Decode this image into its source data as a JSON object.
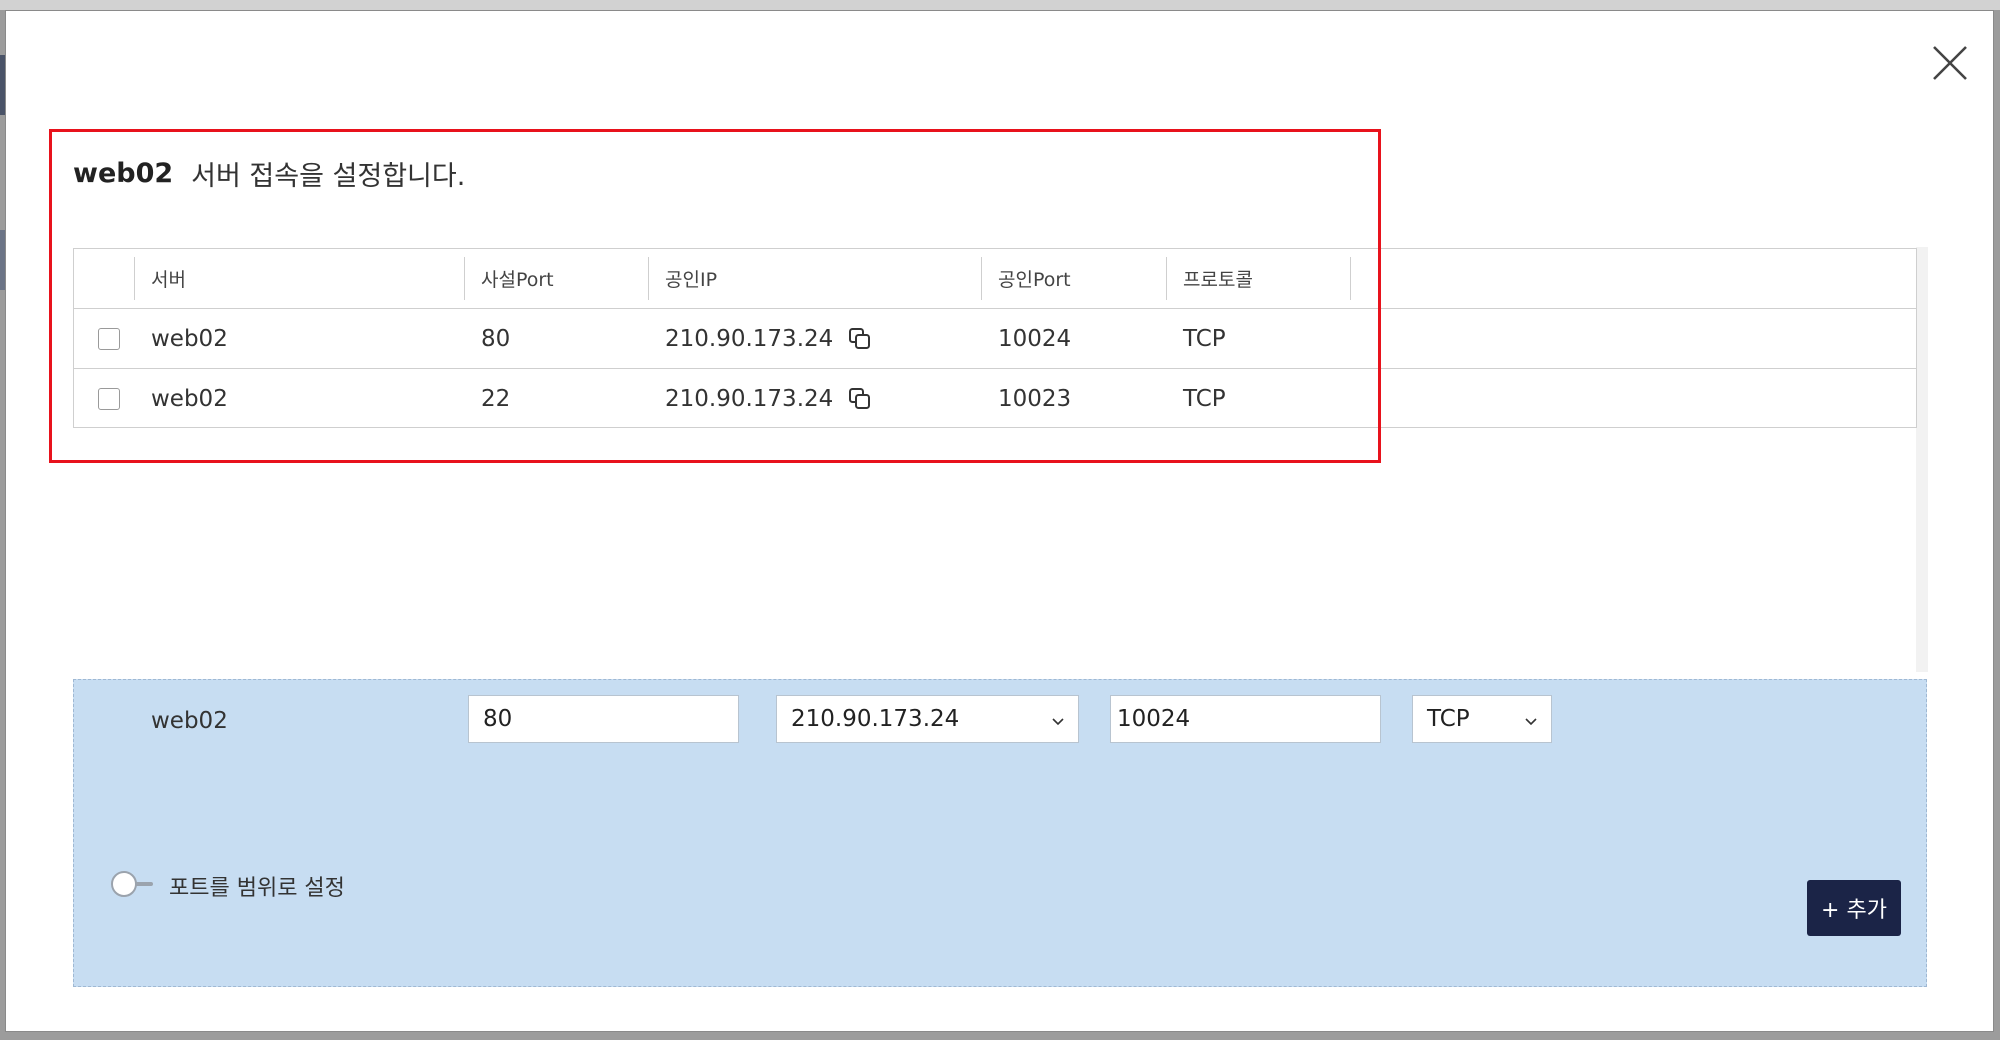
{
  "modal": {
    "title_server": "web02",
    "title_text": "서버 접속을 설정합니다."
  },
  "table": {
    "headers": {
      "server": "서버",
      "private_port": "사설Port",
      "public_ip": "공인IP",
      "public_port": "공인Port",
      "protocol": "프로토콜"
    },
    "rows": [
      {
        "server": "web02",
        "private_port": "80",
        "public_ip": "210.90.173.24",
        "public_port": "10024",
        "protocol": "TCP"
      },
      {
        "server": "web02",
        "private_port": "22",
        "public_ip": "210.90.173.24",
        "public_port": "10023",
        "protocol": "TCP"
      }
    ]
  },
  "form": {
    "server": "web02",
    "private_port": "80",
    "public_ip": "210.90.173.24",
    "public_port": "10024",
    "protocol": "TCP",
    "range_toggle_label": "포트를 범위로 설정",
    "add_button": "+ 추가"
  },
  "colors": {
    "highlight": "#e8121c",
    "form_bg": "#c7ddf2",
    "add_button_bg": "#1b2447"
  },
  "icons": {
    "close": "close-icon",
    "copy": "copy-icon",
    "dropdown": "chevron-down-icon"
  }
}
